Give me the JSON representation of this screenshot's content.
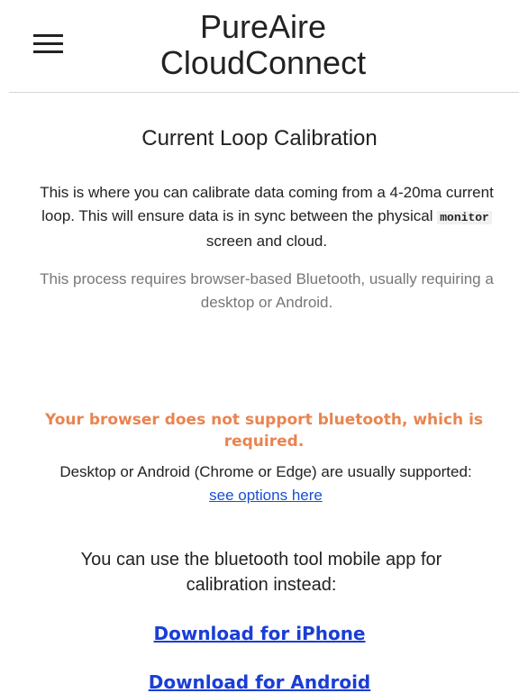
{
  "header": {
    "menu_icon": "hamburger-menu-icon",
    "title_line1": "PureAire",
    "title_line2": "CloudConnect"
  },
  "main": {
    "page_title": "Current Loop Calibration",
    "intro_part1": "This is where you can calibrate data coming from a 4-20ma current loop. This will ensure data is in sync between the physical ",
    "intro_code": "monitor",
    "intro_part2": " screen and cloud.",
    "requirement_note": "This process requires browser-based Bluetooth, usually requiring a desktop or Android.",
    "warning": "Your browser does not support bluetooth, which is required.",
    "support_text": "Desktop or Android (Chrome or Edge) are usually supported:",
    "options_link": "see options here",
    "mobile_note": "You can use the bluetooth tool mobile app for calibration instead:",
    "download_iphone": "Download for iPhone",
    "download_android": "Download for Android"
  },
  "colors": {
    "warning": "#e9844f",
    "link": "#1a3ed6",
    "muted_text": "#777777"
  }
}
